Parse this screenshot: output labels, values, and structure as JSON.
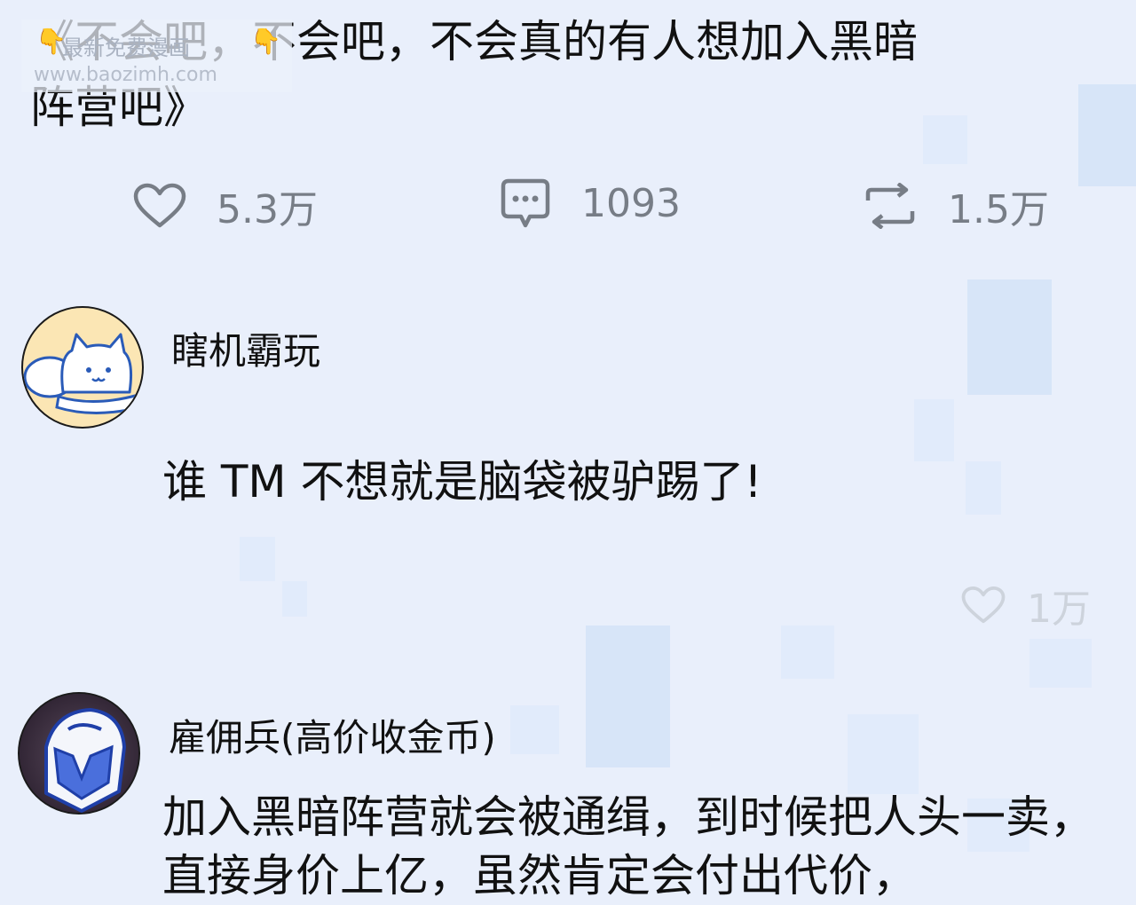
{
  "post": {
    "title": "《不会吧，不会吧，不会真的有人想加入黑暗阵营吧》",
    "watermark": {
      "line1": "最新免费漫画",
      "line2": "www.baozimh.com"
    },
    "actions": {
      "like_count": "5.3万",
      "comment_count": "1093",
      "repost_count": "1.5万"
    }
  },
  "comments": [
    {
      "username": "瞎机霸玩",
      "text": "谁 TM 不想就是脑袋被驴踢了!",
      "like_count": "1万"
    },
    {
      "username": "雇佣兵(高价收金币)",
      "text": "加入黑暗阵营就会被通缉，到时候把人头一卖，直接身价上亿，虽然肯定会付出代价，"
    }
  ],
  "colors": {
    "background": "#e9effb",
    "icon_gray": "#777d86",
    "faded_gray": "#cdd3dc",
    "avatar1_bg": "#fbe6b4",
    "avatar2_bg": "#3a2f40"
  }
}
